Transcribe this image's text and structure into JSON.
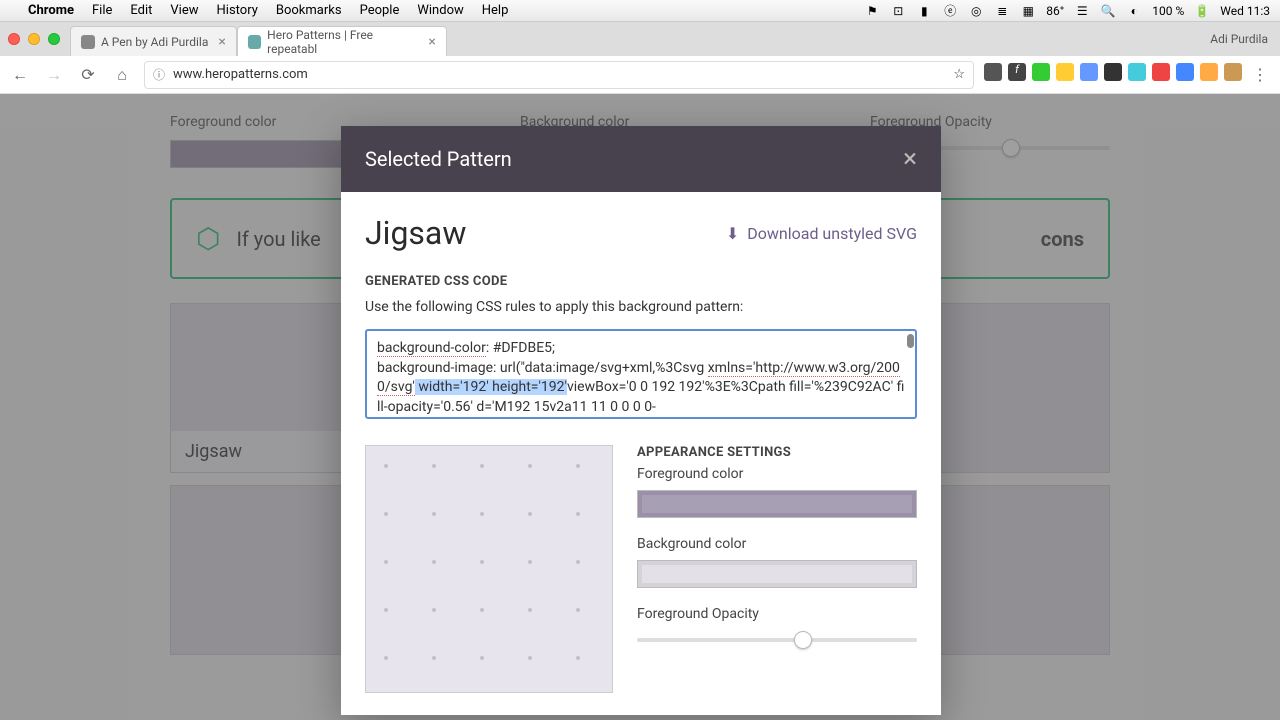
{
  "menubar": {
    "app": "Chrome",
    "items": [
      "File",
      "Edit",
      "View",
      "History",
      "Bookmarks",
      "People",
      "Window",
      "Help"
    ],
    "temp": "86°",
    "battery": "100 %",
    "clock": "Wed 11:3"
  },
  "chrome": {
    "tabs": [
      {
        "title": "A Pen by Adi Purdila"
      },
      {
        "title": "Hero Patterns | Free repeatabl"
      }
    ],
    "user_name": "Adi Purdila",
    "url": "www.heropatterns.com"
  },
  "page": {
    "fg_label": "Foreground color",
    "bg_label": "Background color",
    "op_label": "Foreground Opacity",
    "banner_text_start": "If you like",
    "banner_text_end": "cons",
    "pattern_label": "Jigsaw"
  },
  "modal": {
    "header": "Selected Pattern",
    "name": "Jigsaw",
    "download": "Download unstyled SVG",
    "gen_heading": "GENERATED CSS CODE",
    "hint": "Use the following CSS rules to apply this background pattern:",
    "code": {
      "line1a": "background-color",
      "line1b": ": #DFDBE5;",
      "line2": "background-image: url(\"data:image/svg+xml,%3Csvg",
      "line3a": "xmlns='http://www.w3.org/2000/svg'",
      "line3_sel": " width='192' height='192'",
      "line3b": "viewBox='0 0 192",
      "line4": "192'%3E%3Cpath fill='%239C92AC' fill-opacity='0.56' d='M192 15v2a11 11 0 0 0 0-"
    },
    "appearance_heading": "APPEARANCE SETTINGS",
    "fg_label": "Foreground color",
    "bg_label": "Background color",
    "op_label": "Foreground Opacity"
  }
}
